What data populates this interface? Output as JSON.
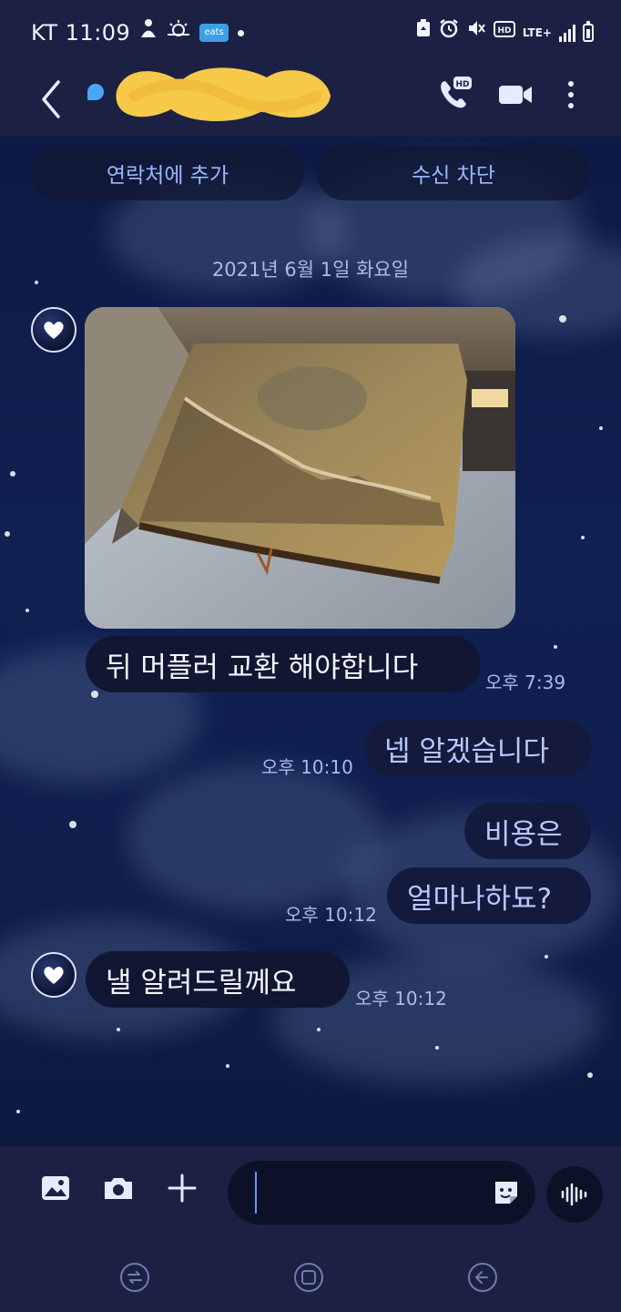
{
  "status_bar": {
    "time": "KT 11:09",
    "app_badge": "eats",
    "network": "LTE+",
    "icons": [
      "person-icon",
      "weather-icon",
      "eats-app-icon",
      "notification-dot",
      "recycle-icon",
      "alarm-icon",
      "mute-icon",
      "hd-voice-icon",
      "lte-icon",
      "signal-icon",
      "battery-icon"
    ]
  },
  "header": {
    "contact_name_redacted": true,
    "call_badge": "HD",
    "icons": [
      "back-chevron-icon",
      "hd-call-icon",
      "video-call-icon",
      "more-options-icon"
    ]
  },
  "actions": {
    "add_contact": "연락처에 추가",
    "block": "수신 차단"
  },
  "date_separator": "2021년 6월 1일 화요일",
  "messages": [
    {
      "direction": "incoming",
      "type": "image",
      "content": "rusted muffler photo"
    },
    {
      "direction": "incoming",
      "text": "뒤 머플러 교환 해야합니다",
      "time": "오후 7:39"
    },
    {
      "direction": "outgoing",
      "text": "넵 알겠습니다",
      "time": "오후 10:10"
    },
    {
      "direction": "outgoing",
      "text": "비용은"
    },
    {
      "direction": "outgoing",
      "text": "얼마나하됴?",
      "time": "오후 10:12"
    },
    {
      "direction": "incoming",
      "text": "낼 알려드릴께요",
      "time": "오후 10:12"
    }
  ],
  "composer": {
    "placeholder": "",
    "icons": [
      "gallery-icon",
      "camera-icon",
      "plus-icon",
      "sticker-icon",
      "voice-wave-icon"
    ]
  },
  "nav": {
    "icons": [
      "recents-icon",
      "home-icon",
      "back-icon"
    ]
  },
  "colors": {
    "bar_background": "#1c2144",
    "bubble_background": "#111733",
    "outgoing_text": "#b9c8ff",
    "link_text": "#9cb6ff",
    "redaction": "#f7c948"
  }
}
